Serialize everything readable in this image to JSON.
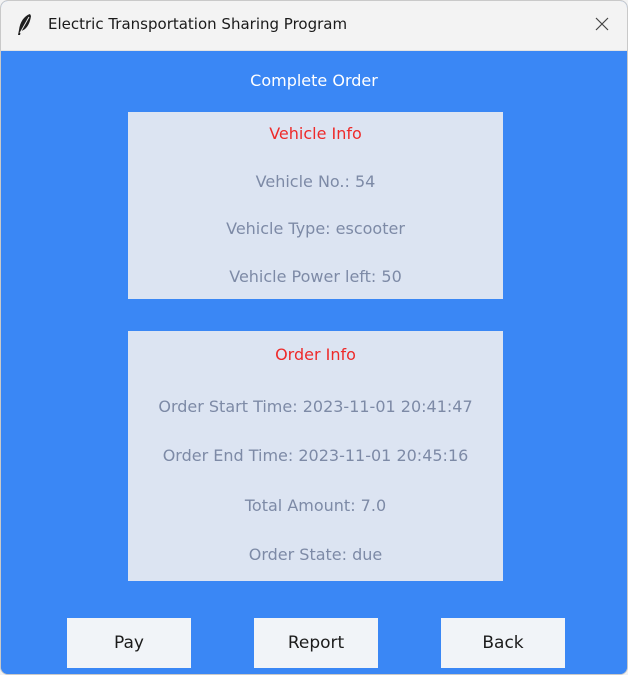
{
  "window": {
    "title": "Electric Transportation Sharing Program",
    "close_icon": "close-icon",
    "app_icon": "feather-icon"
  },
  "page": {
    "title": "Complete Order"
  },
  "vehicle_info": {
    "heading": "Vehicle Info",
    "vehicle_no": "Vehicle No.:  54",
    "vehicle_type": "Vehicle Type: escooter",
    "vehicle_power": "Vehicle Power left: 50"
  },
  "order_info": {
    "heading": "Order Info",
    "start_time": "Order Start Time: 2023-11-01 20:41:47",
    "end_time": "Order End Time: 2023-11-01 20:45:16",
    "total_amount": "Total Amount: 7.0",
    "state": "Order State: due"
  },
  "buttons": {
    "pay": "Pay",
    "report": "Report",
    "back": "Back"
  },
  "colors": {
    "background": "#3a87f5",
    "panel": "#dce4f2",
    "heading": "#ee2a2a",
    "text": "#7d8aa6",
    "button": "#f1f4f8"
  }
}
